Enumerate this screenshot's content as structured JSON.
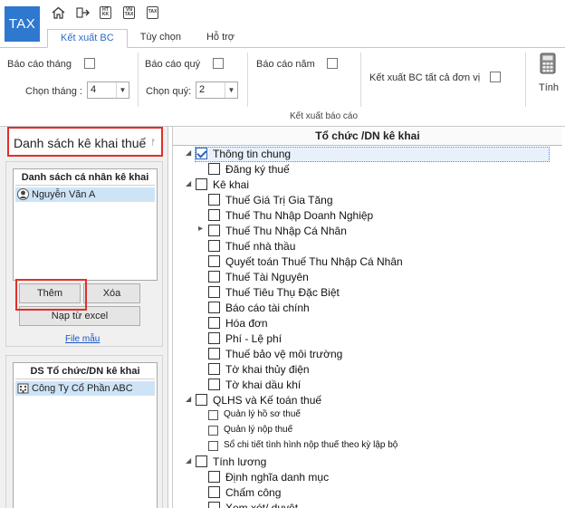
{
  "app": {
    "logo_text": "TAX"
  },
  "quick_access": {
    "ht_kk": "HT\nKK",
    "vn_tax": "VN\nTAX",
    "tax": "TAX"
  },
  "ribbon": {
    "tabs": [
      "Kết xuất BC",
      "Tùy chọn",
      "Hỗ trợ"
    ],
    "active_tab": "Kết xuất BC",
    "bao_cao_thang": "Báo cáo tháng",
    "chon_thang_label": "Chọn tháng :",
    "chon_thang_value": "4",
    "bao_cao_quy": "Báo cáo quý",
    "chon_quy_label": "Chọn quý:",
    "chon_quy_value": "2",
    "bao_cao_nam": "Báo cáo năm",
    "ket_xuat_tat_ca": "Kết xuất BC tất cả đơn vị",
    "tinh_label": "Tính",
    "group_label": "Kết xuất báo cáo"
  },
  "left_panel": {
    "title": "Danh sách kê khai thuế",
    "individuals": {
      "header": "Danh sách cá nhân kê khai",
      "items": [
        "Nguyễn Văn A"
      ]
    },
    "buttons": {
      "them": "Thêm",
      "xoa": "Xóa",
      "nap_tu_excel": "Nạp từ excel"
    },
    "file_mau": "File mẫu",
    "organizations": {
      "header": "DS Tổ chức/DN kê khai",
      "items": [
        "Công Ty Cổ Phần ABC"
      ]
    }
  },
  "tree": {
    "title": "Tổ chức /DN kê khai",
    "rows": [
      {
        "label": "Thông tin chung",
        "level": 0,
        "expander": "open",
        "checked": true
      },
      {
        "label": "Đăng ký thuế",
        "level": 1,
        "expander": "",
        "checked": false
      },
      {
        "label": "Kê khai",
        "level": 0,
        "expander": "open",
        "checked": false
      },
      {
        "label": "Thuế Giá Trị Gia Tăng",
        "level": 1,
        "expander": "",
        "checked": false
      },
      {
        "label": "Thuế Thu Nhập Doanh Nghiệp",
        "level": 1,
        "expander": "",
        "checked": false
      },
      {
        "label": "Thuế Thu Nhập Cá Nhân",
        "level": 1,
        "expander": "closed",
        "checked": false
      },
      {
        "label": "Thuế nhà thầu",
        "level": 1,
        "expander": "",
        "checked": false
      },
      {
        "label": "Quyết toán Thuế Thu Nhập Cá Nhân",
        "level": 1,
        "expander": "",
        "checked": false
      },
      {
        "label": "Thuế Tài Nguyên",
        "level": 1,
        "expander": "",
        "checked": false
      },
      {
        "label": "Thuế Tiêu Thụ Đặc Biệt",
        "level": 1,
        "expander": "",
        "checked": false
      },
      {
        "label": "Báo cáo tài chính",
        "level": 1,
        "expander": "",
        "checked": false
      },
      {
        "label": "Hóa đơn",
        "level": 1,
        "expander": "",
        "checked": false
      },
      {
        "label": "Phí - Lệ phí",
        "level": 1,
        "expander": "",
        "checked": false
      },
      {
        "label": "Thuế bảo vệ môi trường",
        "level": 1,
        "expander": "",
        "checked": false
      },
      {
        "label": "Tờ khai thủy điện",
        "level": 1,
        "expander": "",
        "checked": false
      },
      {
        "label": "Tờ khai dầu khí",
        "level": 1,
        "expander": "",
        "checked": false
      },
      {
        "label": "QLHS và Kế toán thuế",
        "level": 0,
        "expander": "open",
        "checked": false
      },
      {
        "label": "Quản lý hồ sơ thuế",
        "level": 1,
        "expander": "",
        "checked": false,
        "small": true
      },
      {
        "label": "Quản lý nộp thuế",
        "level": 1,
        "expander": "",
        "checked": false,
        "small": true
      },
      {
        "label": "Sổ chi tiết tình hình nộp thuế theo kỳ lập bộ",
        "level": 1,
        "expander": "",
        "checked": false,
        "small": true
      },
      {
        "label": "Tính lương",
        "level": 0,
        "expander": "open",
        "checked": false
      },
      {
        "label": "Định nghĩa danh mục",
        "level": 1,
        "expander": "",
        "checked": false
      },
      {
        "label": "Chấm công",
        "level": 1,
        "expander": "",
        "checked": false
      },
      {
        "label": "Xem xét/ duyệt",
        "level": 1,
        "expander": "",
        "checked": false
      }
    ]
  }
}
